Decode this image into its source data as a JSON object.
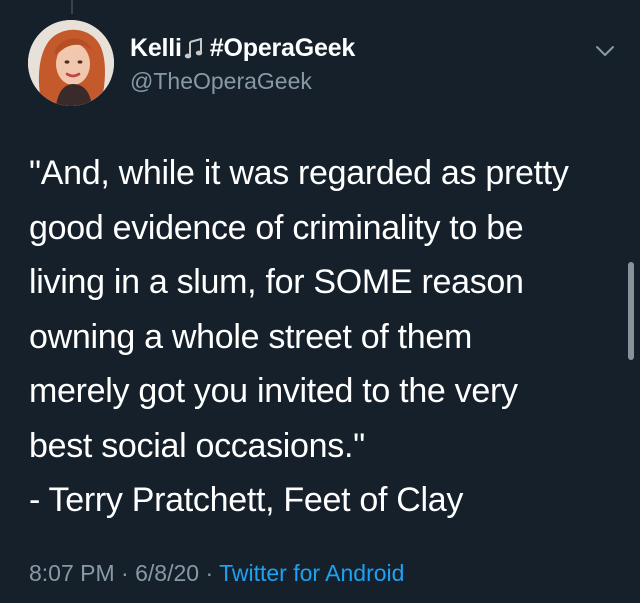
{
  "tweet": {
    "author": {
      "display_name": "Kelli",
      "name_emoji_icon": "musical-notes-icon",
      "name_suffix": "#OperaGeek",
      "handle": "@TheOperaGeek"
    },
    "menu_icon": "chevron-down-icon",
    "text_lines": [
      "\"And, while it was regarded as pretty",
      "good evidence of criminality to be",
      "living in a slum, for SOME reason",
      "owning a whole street of them",
      "merely got you invited to the very",
      "best social occasions.\"",
      "- Terry Pratchett, Feet of Clay"
    ],
    "meta": {
      "time": "8:07 PM",
      "separator": " · ",
      "date": "6/8/20",
      "source": "Twitter for Android"
    }
  },
  "colors": {
    "background": "#15202b",
    "primary_text": "#ffffff",
    "secondary_text": "#8899a6",
    "link": "#1da1f2"
  }
}
